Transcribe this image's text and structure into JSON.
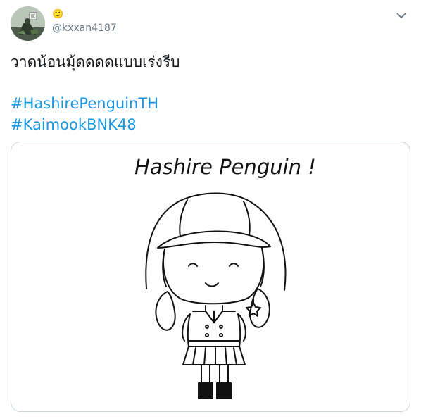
{
  "author": {
    "display_name": "🙂",
    "handle": "@kxxan4187",
    "avatar_icon": "avatar-photo"
  },
  "menu": {
    "icon": "chevron-down-icon"
  },
  "tweet": {
    "text": "วาดน้อนมุ้ดดดดแบบเร่งรีบ",
    "hashtags": [
      "#HashirePenguinTH",
      "#KaimookBNK48"
    ]
  },
  "media": {
    "drawing_title": "Hashire Penguin !",
    "description_icon": "chibi-drawing"
  },
  "colors": {
    "link": "#1b95e0",
    "text": "#14171a",
    "secondary": "#657786",
    "border": "#ccd6dd"
  }
}
